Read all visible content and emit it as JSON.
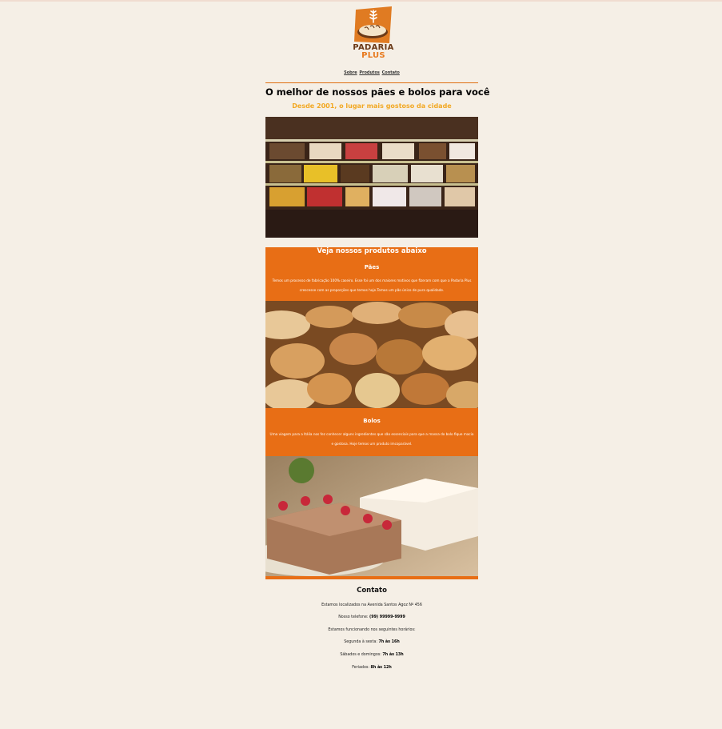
{
  "brand": {
    "line1": "PADARIA",
    "line2": "PLUS"
  },
  "nav": {
    "items": [
      {
        "label": "Sobre"
      },
      {
        "label": "Produtos"
      },
      {
        "label": "Contato"
      }
    ]
  },
  "hero": {
    "headline": "O melhor de nossos pães e bolos para você",
    "subheadline": "Desde 2001, o lugar mais gostoso da cidade"
  },
  "products": {
    "title": "Veja nossos produtos abaixo",
    "items": [
      {
        "title": "Pães",
        "text": "Temos um processo de fabricação 100% caseiro. Esse foi um dos maiores motivos que fizeram com que a Padaria Plus crescesse com as proporções que temos hoje.Temos um pão único de pura qualidade."
      },
      {
        "title": "Bolos",
        "text": "Uma viagem para a Itália nos fez conhecer alguns ingredientes que são essenciais para que a massa do bolo fique macia e gostosa. Hoje temos um produto imcoparável."
      }
    ]
  },
  "contact": {
    "title": "Contato",
    "address": "Estamos localizados na Avenida Santos Agoz Nº 456",
    "phone_label": "Nosso telefone: ",
    "phone": "(99) 99999-9999",
    "hours_intro": "Estamos funcionando nos seguintes horários:",
    "weekdays_label": "Segunda à sexta: ",
    "weekdays": "7h às 16h",
    "weekends_label": "Sábados e domingos: ",
    "weekends": "7h às 13h",
    "holidays_label": "Feriados: ",
    "holidays": "8h às 12h"
  },
  "colors": {
    "background": "#f5efe6",
    "accent": "#e86e15",
    "subheadline": "#f2a823",
    "logo_brown": "#6b3a18"
  }
}
